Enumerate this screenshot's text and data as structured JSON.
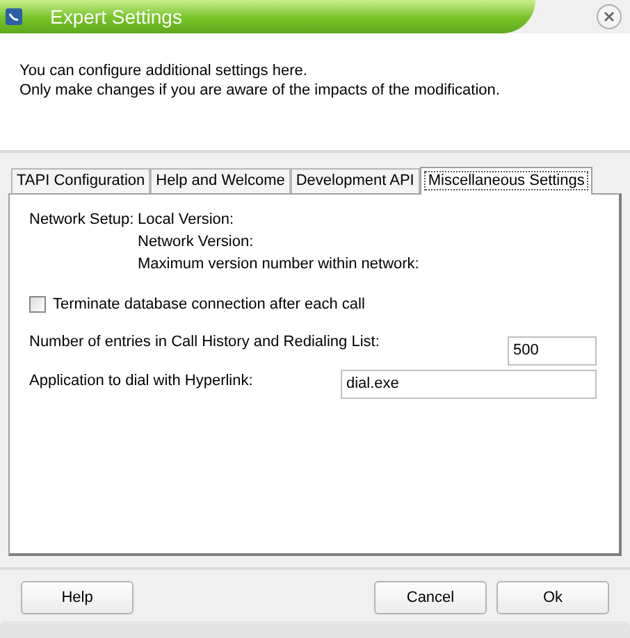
{
  "window": {
    "title": "Expert Settings"
  },
  "intro": [
    "You can configure additional settings here.",
    "Only make changes if you are aware of the impacts of the modification."
  ],
  "tabs": [
    {
      "label": "TAPI Configuration",
      "selected": false
    },
    {
      "label": "Help and Welcome",
      "selected": false
    },
    {
      "label": "Development API",
      "selected": false
    },
    {
      "label": "Miscellaneous Settings",
      "selected": true
    }
  ],
  "network_setup": {
    "label": "Network Setup:",
    "lines": [
      "Local Version:",
      "Network Version:",
      "Maximum version number within network:"
    ]
  },
  "terminate_checkbox": {
    "label": "Terminate database connection after each call",
    "checked": false
  },
  "fields": [
    {
      "label": "Number of entries in Call History and Redialing List:",
      "value": "500",
      "kind": "short"
    },
    {
      "label": "Application to dial with Hyperlink:",
      "value": "dial.exe",
      "kind": "wide"
    }
  ],
  "buttons": [
    {
      "label": "Help"
    },
    {
      "label": "Cancel"
    },
    {
      "label": "Ok"
    }
  ]
}
